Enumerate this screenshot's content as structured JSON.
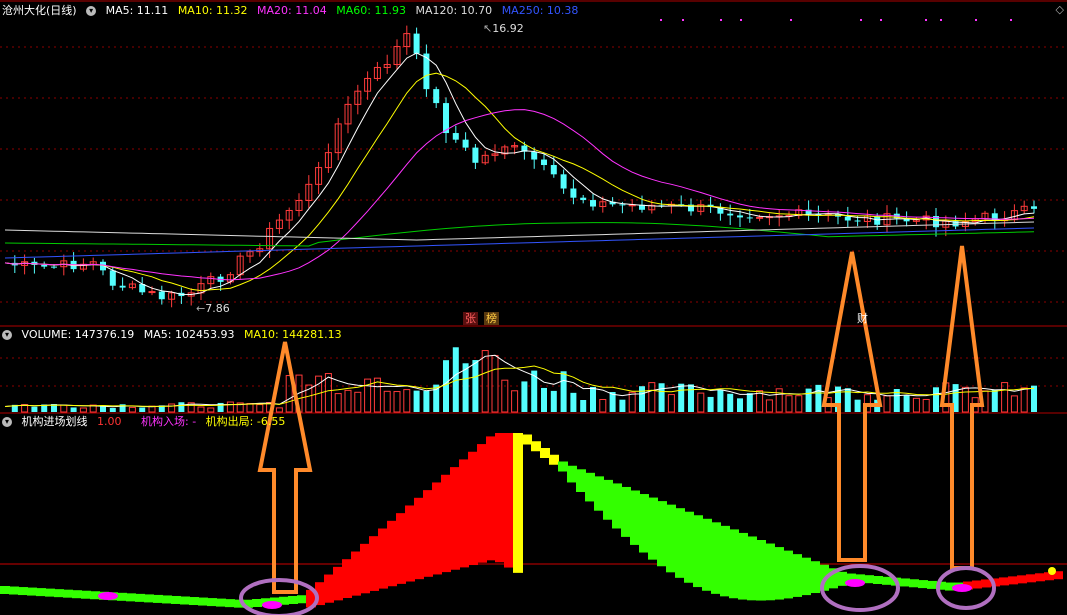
{
  "price_panel": {
    "title": "沧州大化(日线)",
    "indicators": [
      {
        "label": "MA5: 11.11",
        "color": "#ffffff"
      },
      {
        "label": "MA10: 11.32",
        "color": "#ffff00"
      },
      {
        "label": "MA20: 11.04",
        "color": "#ff33ff"
      },
      {
        "label": "MA60: 11.93",
        "color": "#00ff00"
      },
      {
        "label": "MA120: 10.70",
        "color": "#dddddd"
      },
      {
        "label": "MA250: 10.38",
        "color": "#3355ff"
      }
    ],
    "high_label": "16.92",
    "low_label": "7.86",
    "badges": [
      "张",
      "榜",
      "财"
    ]
  },
  "volume_panel": {
    "indicators": [
      {
        "label": "VOLUME: 147376.19",
        "color": "#ffffff"
      },
      {
        "label": "MA5: 102453.93",
        "color": "#ffffff"
      },
      {
        "label": "MA10: 144281.13",
        "color": "#ffff00"
      }
    ]
  },
  "indicator_panel": {
    "name": "机构进场划线",
    "value": "1.00",
    "entry_label": "机构入场: -",
    "exit_label": "机构出局: -6.55"
  },
  "colors": {
    "up": "#ff3b3b",
    "down": "#54ffff",
    "grid": "#8b0000",
    "band_red": "#ff0000",
    "band_green": "#33ff00",
    "band_yellow": "#ffff00",
    "marker_magenta": "#ff00ff",
    "arrow_orange": "#ff8a2a",
    "circle_purple": "#b06fc0"
  },
  "icons": [
    "settings-circle-icon",
    "diamond-icon"
  ]
}
